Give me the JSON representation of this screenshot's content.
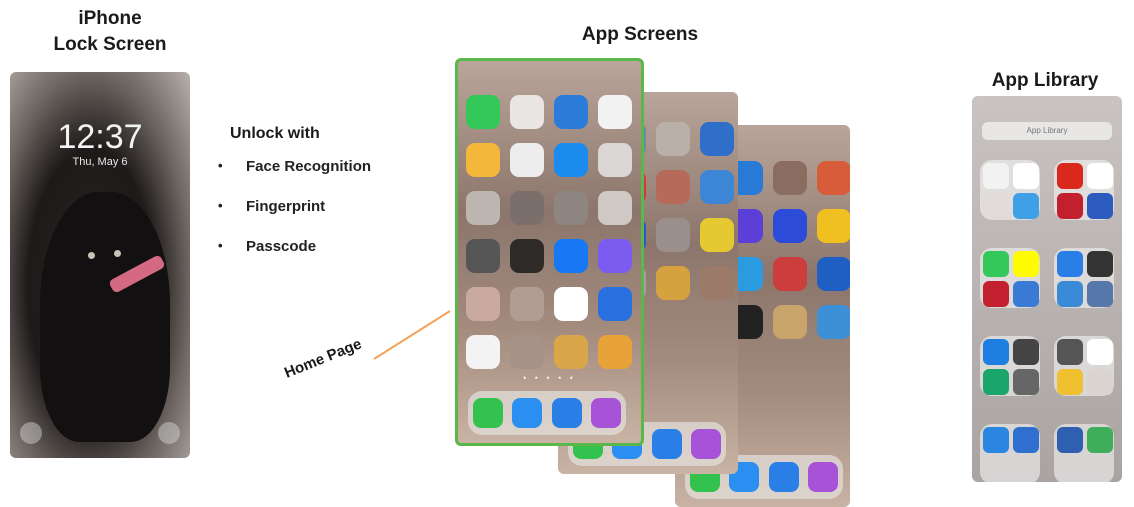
{
  "titles": {
    "lock_line1": "iPhone",
    "lock_line2": "Lock Screen",
    "apps": "App Screens",
    "library": "App Library"
  },
  "unlock": {
    "heading": "Unlock with",
    "methods": [
      "Face Recognition",
      "Fingerprint",
      "Passcode"
    ]
  },
  "home_label": "Home Page",
  "lock_screen": {
    "time": "12:37",
    "date": "Thu, May 6"
  },
  "colors": {
    "home_highlight": "#5cb74a",
    "arrow": "#f4a25a"
  },
  "library_search": "App Library"
}
